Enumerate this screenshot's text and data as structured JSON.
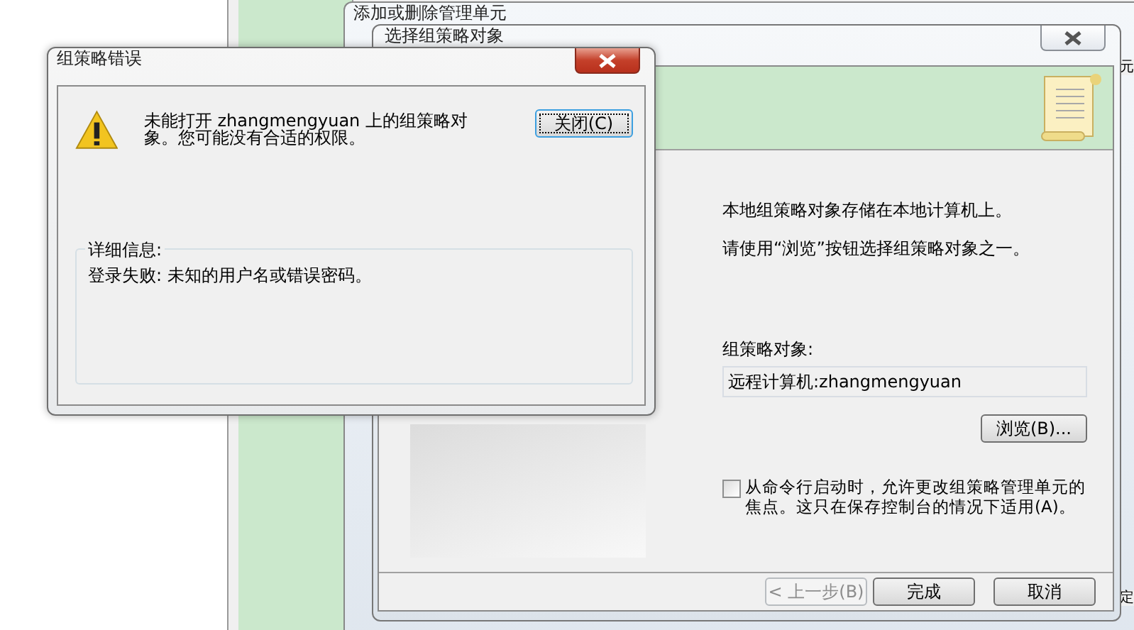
{
  "background_window": {
    "fragments": [
      "元",
      "定"
    ]
  },
  "snapin_window": {
    "title": "添加或删除管理单元"
  },
  "wizard": {
    "title": "选择组策略对象",
    "intro": [
      "本地组策略对象存储在本地计算机上。",
      "请使用“浏览”按钮选择组策略对象之一。"
    ],
    "gpo_label": "组策略对象:",
    "gpo_value": "远程计算机:zhangmengyuan",
    "browse_button": "浏览(B)...",
    "focus_checkbox": {
      "label": "从命令行启动时，允许更改组策略管理单元的焦点。这只在保存控制台的情况下适用(A)。",
      "checked": false
    },
    "buttons": [
      {
        "label": "< 上一步(B)",
        "disabled": true
      },
      {
        "label": "完成",
        "disabled": false
      },
      {
        "label": "取消",
        "disabled": false
      }
    ]
  },
  "error_dialog": {
    "title": "组策略错误",
    "message": "未能打开 zhangmengyuan 上的组策略对象。您可能没有合适的权限。",
    "close_button": "关闭(C)",
    "details_label": "详细信息:",
    "details": "登录失败: 未知的用户名或错误密码。"
  }
}
